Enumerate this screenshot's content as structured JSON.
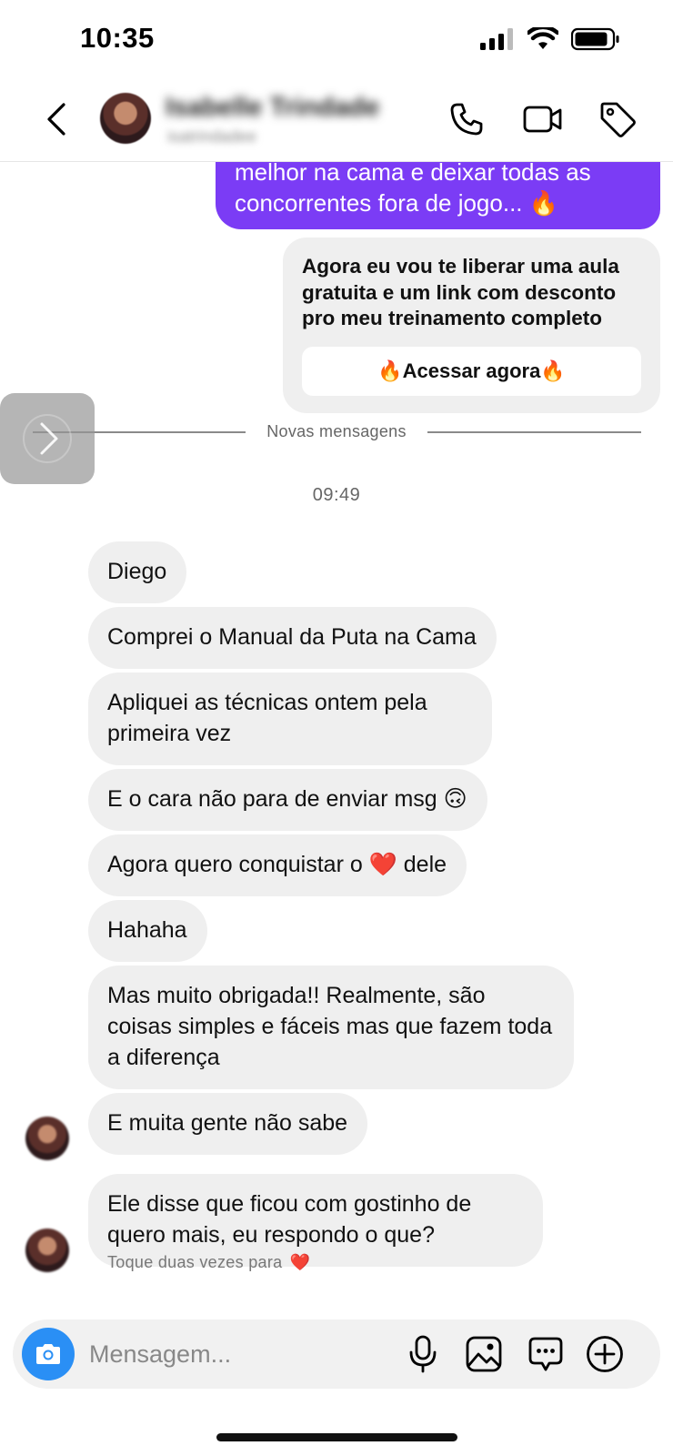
{
  "status_bar": {
    "time": "10:35"
  },
  "header": {
    "contact_name": "Isabelle Trindade",
    "contact_handle": "isatrindadee"
  },
  "chat": {
    "sent_message_lines": [
      "melhor na cama  e deixar todas as",
      "concorrentes fora de jogo... 🔥"
    ],
    "card": {
      "text": "Agora eu vou te liberar uma aula gratuita e um link com desconto pro meu treinamento completo",
      "button_label": "🔥Acessar agora🔥"
    },
    "divider_label": "Novas mensagens",
    "timestamp": "09:49",
    "messages": [
      {
        "text": "Diego"
      },
      {
        "text": "Comprei o Manual da Puta na Cama"
      },
      {
        "text": "Apliquei as técnicas ontem pela primeira vez"
      },
      {
        "text": "E o cara não para de enviar msg 🙃"
      },
      {
        "text": "Agora quero conquistar o ❤️ dele"
      },
      {
        "text": "Hahaha"
      },
      {
        "text": "Mas muito obrigada!! Realmente, são coisas simples e fáceis mas que fazem toda a diferença"
      },
      {
        "text": "E muita gente não sabe"
      },
      {
        "text": "Ele disse que ficou com gostinho de quero mais, eu respondo o que?"
      }
    ],
    "hint": "Toque duas vezes para",
    "hint_icon": "❤️"
  },
  "composer": {
    "placeholder": "Mensagem..."
  },
  "colors": {
    "sent_bubble": "#7b3cf5",
    "received_bubble": "#efefef",
    "camera_button": "#2a8ff5"
  }
}
